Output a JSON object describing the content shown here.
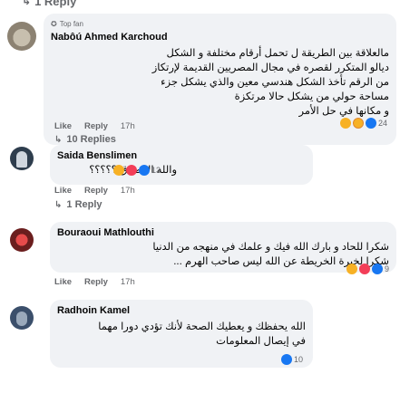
{
  "top_reply": {
    "label": "1 Reply"
  },
  "comments": [
    {
      "badge": "Top fan",
      "name": "Nabôú Ahmed Karchoud",
      "lines": [
        "مالعلاقة بين الطريقة ل تحمل أرقام مختلفة و الشكل",
        "ديالو المتكرر لقصره في مجال المصريين القديمة لإرتكاز ",
        "من الرقم تأخذ الشكل هندسي معين والذي يشكل جزء ",
        "مساحة حولي من يشكل حالا مرتكزة ",
        "و مكانها في حل الأمر"
      ],
      "react_count": "24",
      "actions": {
        "like": "Like",
        "reply": "Reply",
        "time": "17h"
      },
      "replies": "10 Replies"
    },
    {
      "name": "Saida Benslimen",
      "lines": [
        "والله الا صدق ؟؟؟؟؟"
      ],
      "react_count": "13",
      "actions": {
        "like": "Like",
        "reply": "Reply",
        "time": "17h"
      },
      "replies": "1 Reply"
    },
    {
      "name": "Bouraoui Mathlouthi",
      "lines": [
        "شكرا للحاد و بارك الله فيك و علمك في منهجه من الدنيا",
        "شكرا لخبرة الخريطة عن الله ليس صاحب الهرم ..."
      ],
      "react_count": "9",
      "actions": {
        "like": "Like",
        "reply": "Reply",
        "time": "17h"
      }
    },
    {
      "name": "Radhoin Kamel",
      "lines": [
        "الله يحفظك و يعطيك الصحة لأنك تؤدي دورا مهما",
        "في إيصال المعلومات"
      ],
      "react_count": "10"
    }
  ]
}
